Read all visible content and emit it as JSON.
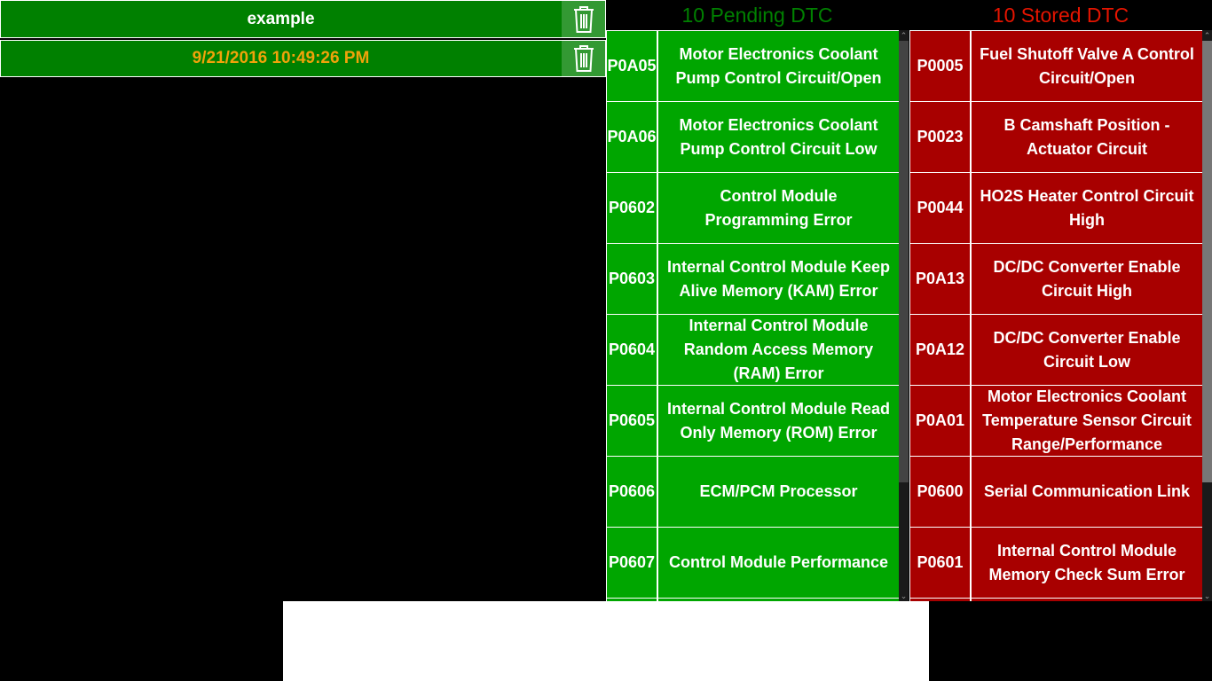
{
  "sessions": [
    {
      "label": "example",
      "delete_icon": "trash-icon"
    },
    {
      "label": "9/21/2016 10:49:26 PM",
      "delete_icon": "trash-icon"
    }
  ],
  "pending": {
    "title": "10 Pending DTC",
    "color": "#00a600",
    "items": [
      {
        "code": "P0A05",
        "desc": "Motor Electronics Coolant\nPump Control Circuit/Open"
      },
      {
        "code": "P0A06",
        "desc": "Motor Electronics Coolant\nPump Control Circuit Low"
      },
      {
        "code": "P0602",
        "desc": "Control Module\nProgramming Error"
      },
      {
        "code": "P0603",
        "desc": "Internal Control Module Keep\nAlive Memory (KAM) Error"
      },
      {
        "code": "P0604",
        "desc": "Internal Control Module\nRandom Access Memory\n(RAM) Error"
      },
      {
        "code": "P0605",
        "desc": "Internal Control Module Read\nOnly Memory (ROM) Error"
      },
      {
        "code": "P0606",
        "desc": "ECM/PCM Processor"
      },
      {
        "code": "P0607",
        "desc": "Control Module Performance"
      }
    ]
  },
  "stored": {
    "title": "10 Stored DTC",
    "color": "#a80000",
    "items": [
      {
        "code": "P0005",
        "desc": "Fuel Shutoff Valve A Control\nCircuit/Open"
      },
      {
        "code": "P0023",
        "desc": "B Camshaft Position -\nActuator Circuit"
      },
      {
        "code": "P0044",
        "desc": "HO2S Heater Control Circuit\nHigh"
      },
      {
        "code": "P0A13",
        "desc": "DC/DC Converter Enable\nCircuit High"
      },
      {
        "code": "P0A12",
        "desc": "DC/DC Converter Enable\nCircuit Low"
      },
      {
        "code": "P0A01",
        "desc": "Motor Electronics Coolant\nTemperature Sensor Circuit\nRange/Performance"
      },
      {
        "code": "P0600",
        "desc": "Serial Communication Link"
      },
      {
        "code": "P0601",
        "desc": "Internal Control Module\nMemory Check Sum Error"
      }
    ]
  }
}
